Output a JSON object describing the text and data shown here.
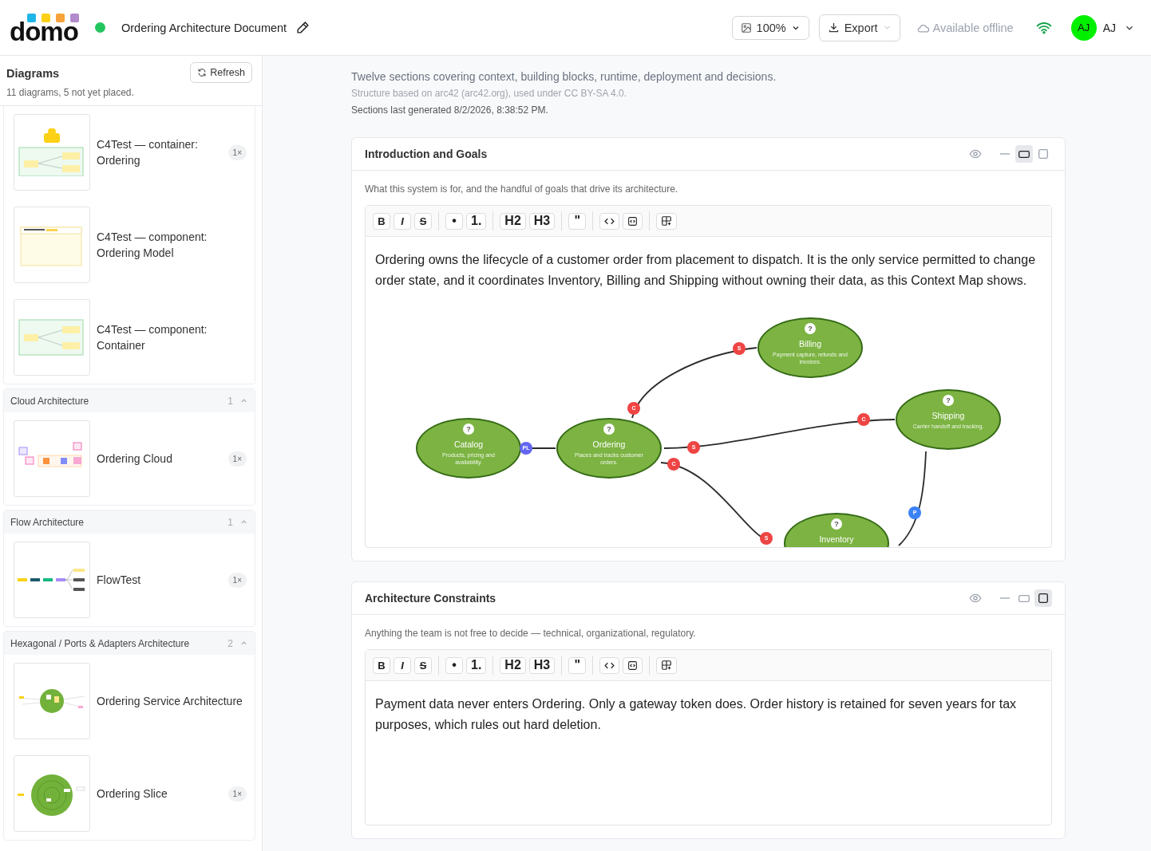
{
  "app": {
    "logo": "domo",
    "online": true,
    "title": "Ordering Architecture Document",
    "zoom": "100%",
    "export": "Export",
    "offline": "Available offline",
    "avatar": "AJ",
    "user": "AJ"
  },
  "sidebar": {
    "title": "Diagrams",
    "refresh": "Refresh",
    "summary": "11 diagrams, 5 not yet placed.",
    "groups": [
      {
        "items": [
          {
            "title": "C4Test — container: Ordering",
            "kind": "c4-container",
            "uses": "1×"
          },
          {
            "title": "C4Test — component: Ordering Model",
            "kind": "c4-model"
          },
          {
            "title": "C4Test — component: Container",
            "kind": "c4-component"
          }
        ]
      },
      {
        "name": "Cloud Architecture",
        "count": "1",
        "expanded": true,
        "items": [
          {
            "title": "Ordering Cloud",
            "kind": "cloud",
            "uses": "1×"
          }
        ]
      },
      {
        "name": "Flow Architecture",
        "count": "1",
        "expanded": true,
        "items": [
          {
            "title": "FlowTest",
            "kind": "flow",
            "uses": "1×"
          }
        ]
      },
      {
        "name": "Hexagonal / Ports & Adapters Architecture",
        "count": "2",
        "expanded": true,
        "items": [
          {
            "title": "Ordering Service Architecture",
            "kind": "hex"
          },
          {
            "title": "Ordering Slice",
            "kind": "slice",
            "uses": "1×"
          }
        ]
      }
    ]
  },
  "intro": [
    "Twelve sections covering context, building blocks, runtime, deployment and decisions.",
    "Structure based on arc42 (arc42.org), used under CC BY-SA 4.0.",
    "Sections last generated 8/2/2026, 8:38:52 PM."
  ],
  "sections": [
    {
      "title": "Introduction and Goals",
      "view_modes": [
        {
          "kind": "collapse",
          "selected": false
        },
        {
          "kind": "medium",
          "selected": true
        },
        {
          "kind": "full",
          "selected": false
        }
      ],
      "description": "What this system is for, and the handful of goals that drive its architecture.",
      "toolbar": [
        {
          "kind": "bold",
          "label": "B"
        },
        {
          "kind": "italic",
          "label": "I"
        },
        {
          "kind": "strike",
          "label": "S"
        },
        {
          "kind": "sep"
        },
        {
          "kind": "text",
          "label": "•"
        },
        {
          "kind": "text",
          "label": "1."
        },
        {
          "kind": "sep"
        },
        {
          "kind": "text",
          "label": "H2"
        },
        {
          "kind": "text",
          "label": "H3"
        },
        {
          "kind": "sep"
        },
        {
          "kind": "text",
          "label": "\""
        },
        {
          "kind": "sep"
        },
        {
          "kind": "code"
        },
        {
          "kind": "codeblock"
        },
        {
          "kind": "sep"
        },
        {
          "kind": "table"
        }
      ],
      "body": "Ordering owns the lifecycle of a customer order from placement to dispatch. It is the only service permitted to change order state, and it coordinates Inventory, Billing and Shipping without owning their data, as this Context Map shows.",
      "diagram": {
        "nodes": [
          {
            "name": "Catalog",
            "description": "Products, pricing and availability.",
            "marker": "?"
          },
          {
            "name": "Ordering",
            "description": "Places and tracks customer orders.",
            "marker": "?"
          },
          {
            "name": "Billing",
            "description": "Payment capture, refunds and invoices.",
            "marker": "?"
          },
          {
            "name": "Shipping",
            "description": "Carrier handoff and tracking.",
            "marker": "?"
          },
          {
            "name": "Inventory",
            "marker": "?"
          }
        ],
        "edges": [
          {
            "badges": [
              {
                "text": "PL",
                "color": "#6366f1"
              }
            ]
          },
          {
            "badges": [
              {
                "text": "C",
                "color": "#ef4444"
              },
              {
                "text": "S",
                "color": "#ef4444"
              }
            ]
          },
          {
            "badges": [
              {
                "text": "S",
                "color": "#ef4444"
              },
              {
                "text": "C",
                "color": "#ef4444"
              }
            ]
          },
          {
            "badges": [
              {
                "text": "C",
                "color": "#ef4444"
              },
              {
                "text": "S",
                "color": "#ef4444"
              }
            ]
          },
          {
            "badges": [
              {
                "text": "P",
                "color": "#3b82f6"
              }
            ]
          }
        ]
      }
    },
    {
      "title": "Architecture Constraints",
      "view_modes": [
        {
          "kind": "collapse",
          "selected": false
        },
        {
          "kind": "medium",
          "selected": false
        },
        {
          "kind": "full",
          "selected": true
        }
      ],
      "description": "Anything the team is not free to decide — technical, organizational, regulatory.",
      "toolbar": [
        {
          "kind": "bold",
          "label": "B"
        },
        {
          "kind": "italic",
          "label": "I"
        },
        {
          "kind": "strike",
          "label": "S"
        },
        {
          "kind": "sep"
        },
        {
          "kind": "text",
          "label": "•"
        },
        {
          "kind": "text",
          "label": "1."
        },
        {
          "kind": "sep"
        },
        {
          "kind": "text",
          "label": "H2"
        },
        {
          "kind": "text",
          "label": "H3"
        },
        {
          "kind": "sep"
        },
        {
          "kind": "text",
          "label": "\""
        },
        {
          "kind": "sep"
        },
        {
          "kind": "code"
        },
        {
          "kind": "codeblock"
        },
        {
          "kind": "sep"
        },
        {
          "kind": "table"
        }
      ],
      "body": "Payment data never enters Ordering. Only a gateway token does. Order history is retained for seven years for tax purposes, which rules out hard deletion."
    }
  ]
}
